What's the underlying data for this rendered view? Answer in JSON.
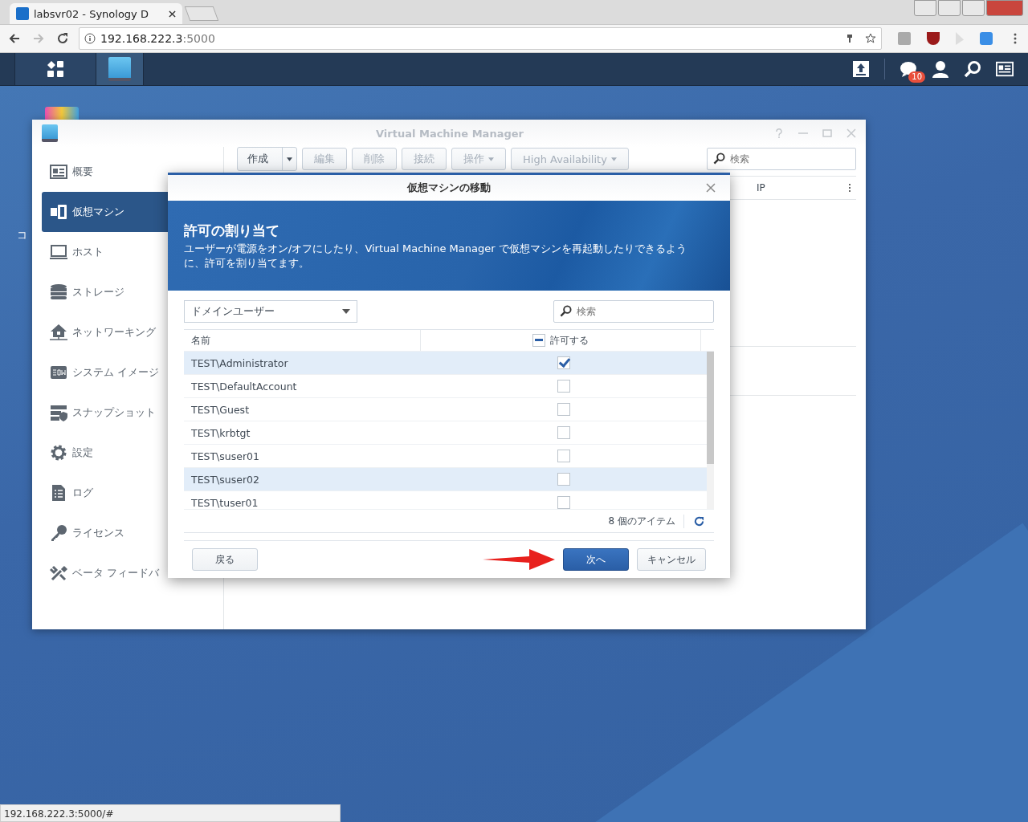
{
  "browser": {
    "tab_title": "labsvr02 - Synology D",
    "url_host": "192.168.222.3",
    "url_port": ":5000",
    "status_url": "192.168.222.3:5000/#"
  },
  "taskbar": {
    "notification_count": "10"
  },
  "desktop_label": "コ",
  "window": {
    "title": "Virtual Machine Manager",
    "sidebar": [
      {
        "label": "概要",
        "selected": false
      },
      {
        "label": "仮想マシン",
        "selected": true
      },
      {
        "label": "ホスト",
        "selected": false
      },
      {
        "label": "ストレージ",
        "selected": false
      },
      {
        "label": "ネットワーキング",
        "selected": false
      },
      {
        "label": "システム イメージ",
        "selected": false
      },
      {
        "label": "スナップショット",
        "selected": false
      },
      {
        "label": "設定",
        "selected": false
      },
      {
        "label": "ログ",
        "selected": false
      },
      {
        "label": "ライセンス",
        "selected": false
      },
      {
        "label": "ベータ フィードバ",
        "selected": false
      }
    ],
    "toolbar": [
      {
        "label": "作成",
        "kind": "split",
        "disabled": false
      },
      {
        "label": "編集",
        "kind": "plain",
        "disabled": true
      },
      {
        "label": "削除",
        "kind": "plain",
        "disabled": true
      },
      {
        "label": "接続",
        "kind": "plain",
        "disabled": true
      },
      {
        "label": "操作",
        "kind": "menu",
        "disabled": true
      },
      {
        "label": "High Availability",
        "kind": "menu",
        "disabled": true
      }
    ],
    "search_placeholder": "検索",
    "columns": [
      "IP"
    ]
  },
  "dialog": {
    "title": "仮想マシンの移動",
    "heading": "許可の割り当て",
    "description": "ユーザーが電源をオン/オフにしたり、Virtual Machine Manager で仮想マシンを再起動したりできるように、許可を割り当てます。",
    "filter": "ドメインユーザー",
    "search_placeholder": "検索",
    "columns": [
      "名前",
      "許可する"
    ],
    "header_partial": true,
    "rows": [
      {
        "name": "TEST\\Administrator",
        "checked": true,
        "selected": true
      },
      {
        "name": "TEST\\DefaultAccount",
        "checked": false,
        "selected": false
      },
      {
        "name": "TEST\\Guest",
        "checked": false,
        "selected": false
      },
      {
        "name": "TEST\\krbtgt",
        "checked": false,
        "selected": false
      },
      {
        "name": "TEST\\suser01",
        "checked": false,
        "selected": false
      },
      {
        "name": "TEST\\suser02",
        "checked": false,
        "selected": true
      },
      {
        "name": "TEST\\tuser01",
        "checked": false,
        "selected": false
      }
    ],
    "item_count": "8 個のアイテム",
    "buttons": [
      {
        "label": "戻る",
        "kind": "secondary"
      },
      {
        "label": "次へ",
        "kind": "primary"
      },
      {
        "label": "キャンセル",
        "kind": "secondary"
      }
    ]
  }
}
